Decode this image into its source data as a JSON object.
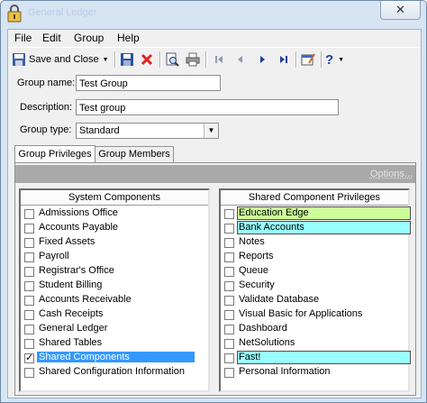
{
  "window": {
    "title": "General Ledger",
    "close_glyph": "✕"
  },
  "menu": [
    "File",
    "Edit",
    "Group",
    "Help"
  ],
  "toolbar": {
    "save_close_label": "Save and Close",
    "icons": [
      "save-icon",
      "delete-icon",
      "preview-icon",
      "print-icon",
      "first-record-icon",
      "previous-record-icon",
      "next-record-icon",
      "last-record-icon",
      "properties-icon",
      "help-icon"
    ]
  },
  "form": {
    "group_name_label": "Group name:",
    "group_name_value": "Test Group",
    "description_label": "Description:",
    "description_value": "Test group",
    "group_type_label": "Group type:",
    "group_type_value": "Standard"
  },
  "tabs": [
    {
      "label": "Group Privileges",
      "active": true
    },
    {
      "label": "Group Members",
      "active": false
    }
  ],
  "options_label": "Options...",
  "system_components": {
    "header": "System Components",
    "items": [
      {
        "label": "Admissions Office",
        "checked": false
      },
      {
        "label": "Accounts Payable",
        "checked": false
      },
      {
        "label": "Fixed Assets",
        "checked": false
      },
      {
        "label": "Payroll",
        "checked": false
      },
      {
        "label": "Registrar's Office",
        "checked": false
      },
      {
        "label": "Student Billing",
        "checked": false
      },
      {
        "label": "Accounts Receivable",
        "checked": false
      },
      {
        "label": "Cash Receipts",
        "checked": false
      },
      {
        "label": "General Ledger",
        "checked": false
      },
      {
        "label": "Shared Tables",
        "checked": false
      },
      {
        "label": "Shared Components",
        "checked": true,
        "selected": true
      },
      {
        "label": "Shared Configuration Information",
        "checked": false
      }
    ]
  },
  "shared_privileges": {
    "header": "Shared Component Privileges",
    "items": [
      {
        "label": "Education Edge",
        "checked": false,
        "highlight": "#ccff99"
      },
      {
        "label": "Bank Accounts",
        "checked": false,
        "highlight": "#99ffff"
      },
      {
        "label": "Notes",
        "checked": false
      },
      {
        "label": "Reports",
        "checked": false
      },
      {
        "label": "Queue",
        "checked": false
      },
      {
        "label": "Security",
        "checked": false
      },
      {
        "label": "Validate Database",
        "checked": false
      },
      {
        "label": "Visual Basic for Applications",
        "checked": false
      },
      {
        "label": "Dashboard",
        "checked": false
      },
      {
        "label": "NetSolutions",
        "checked": false
      },
      {
        "label": "Fast!",
        "checked": false,
        "highlight": "#99ffff"
      },
      {
        "label": "Personal Information",
        "checked": false
      }
    ]
  }
}
